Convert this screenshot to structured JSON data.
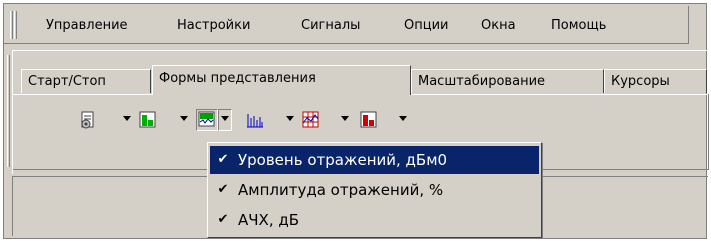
{
  "menubar": {
    "items": [
      "Управление",
      "Настройки",
      "Сигналы",
      "Опции",
      "Окна",
      "Помощь"
    ]
  },
  "tabs": [
    {
      "label": "Старт/Стоп",
      "active": false
    },
    {
      "label": "Формы представления",
      "active": true
    },
    {
      "label": "Масштабирование",
      "active": false
    },
    {
      "label": "Курсоры",
      "active": false
    }
  ],
  "toolbar": {
    "buttons": [
      {
        "icon": "settings-document-icon",
        "color": "#808080"
      },
      {
        "icon": "green-chart-icon",
        "color": "#00a000"
      },
      {
        "icon": "waveform-icon",
        "color": "#00a000",
        "pressed": true
      },
      {
        "icon": "bar-spectrum-icon",
        "color": "#0000c0"
      },
      {
        "icon": "grid-plot-icon",
        "color": "#c00000"
      },
      {
        "icon": "red-chart-icon",
        "color": "#c00000"
      }
    ]
  },
  "dropdown": {
    "items": [
      {
        "check": "✔",
        "label": "Уровень отражений, дБм0",
        "selected": true
      },
      {
        "check": "✔",
        "label": "Амплитуда отражений, %",
        "selected": false
      },
      {
        "check": "✔",
        "label": "АЧХ, дБ",
        "selected": false
      }
    ]
  },
  "colors": {
    "face": "#d4d0c8",
    "highlight": "#0a246a"
  }
}
